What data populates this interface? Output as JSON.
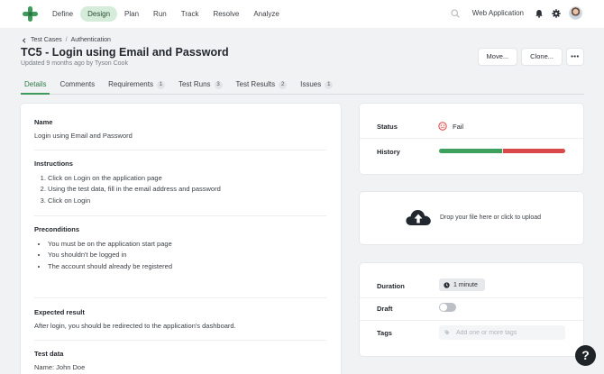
{
  "nav": {
    "items": [
      {
        "label": "Define",
        "active": false
      },
      {
        "label": "Design",
        "active": true
      },
      {
        "label": "Plan",
        "active": false
      },
      {
        "label": "Run",
        "active": false
      },
      {
        "label": "Track",
        "active": false
      },
      {
        "label": "Resolve",
        "active": false
      },
      {
        "label": "Analyze",
        "active": false
      }
    ],
    "workspace": "Web Application"
  },
  "colors": {
    "brand_green": "#3f9a5c",
    "active_nav_bg": "#d4ecd9",
    "fail_red": "#d84a4a",
    "pass_green": "#3da05c"
  },
  "header": {
    "breadcrumb": [
      "Test Cases",
      "Authentication"
    ],
    "title": "TC5 - Login using Email and Password",
    "updated": "Updated 9 months ago by Tyson Cook",
    "buttons": {
      "move": "Move...",
      "clone": "Clone...",
      "more": "•••"
    }
  },
  "tabs": [
    {
      "label": "Details",
      "badge": "",
      "active": true
    },
    {
      "label": "Comments",
      "badge": "",
      "active": false
    },
    {
      "label": "Requirements",
      "badge": "1",
      "active": false
    },
    {
      "label": "Test Runs",
      "badge": "3",
      "active": false
    },
    {
      "label": "Test Results",
      "badge": "2",
      "active": false
    },
    {
      "label": "Issues",
      "badge": "1",
      "active": false
    }
  ],
  "details": {
    "name": {
      "title": "Name",
      "value": "Login using Email and Password"
    },
    "instructions": {
      "title": "Instructions",
      "steps": [
        "Click on Login on the application page",
        "Using the test data, fill in the email address and password",
        "Click on Login"
      ]
    },
    "preconditions": {
      "title": "Preconditions",
      "items": [
        "You must be on the application start page",
        "You shouldn't be logged in",
        "The account should already be registered"
      ]
    },
    "expected": {
      "title": "Expected result",
      "value": "After login, you should be redirected to the application's dashboard."
    },
    "test_data": {
      "title": "Test data",
      "lines": [
        "Name: John Doe"
      ]
    }
  },
  "status_card": {
    "status_label": "Status",
    "status_value": "Fail",
    "history_label": "History",
    "history": {
      "pass_fraction": 0.5,
      "fail_fraction": 0.5
    }
  },
  "upload": {
    "text": "Drop your file here or click to upload"
  },
  "meta": {
    "duration_label": "Duration",
    "duration_value": "1 minute",
    "draft_label": "Draft",
    "draft_on": false,
    "tags_label": "Tags",
    "tags_placeholder": "Add one or more tags"
  },
  "help": {
    "label": "?"
  }
}
